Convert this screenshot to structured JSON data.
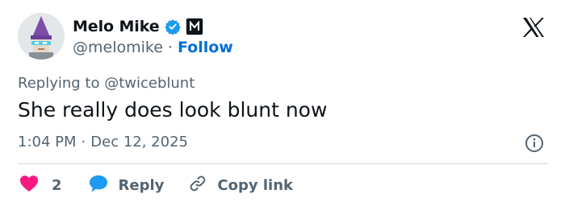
{
  "author": {
    "display_name": "Melo Mike",
    "handle": "@melomike",
    "separator": "·",
    "follow_label": "Follow"
  },
  "reply_context": {
    "prefix": "Replying to",
    "mention": "@twiceblunt"
  },
  "tweet": {
    "text": "She really does look blunt now",
    "time": "1:04 PM",
    "separator": "·",
    "date": "Dec 12, 2025"
  },
  "actions": {
    "like_count": "2",
    "reply_label": "Reply",
    "copy_link_label": "Copy link"
  },
  "colors": {
    "accent": "#006fd6",
    "like": "#f91880",
    "reply": "#1d9bf0",
    "verified": "#1d9bf0",
    "secondary_text": "#536471"
  },
  "icons": [
    "x-logo-icon",
    "verified-badge-icon",
    "affiliation-badge-icon",
    "info-icon",
    "heart-icon",
    "reply-bubble-icon",
    "link-icon"
  ]
}
